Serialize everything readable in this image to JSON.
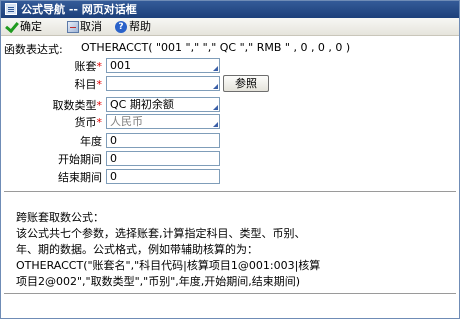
{
  "window": {
    "title": "公式导航 -- 网页对话框"
  },
  "toolbar": {
    "ok_label": "确定",
    "cancel_label": "取消",
    "help_label": "帮助",
    "help_glyph": "?"
  },
  "formula": {
    "label": "函数表达式:",
    "value": "OTHERACCT( \"001 \",\"  \",\" QC \",\" RMB \" , 0 , 0 , 0 )"
  },
  "form": {
    "required_mark": "*",
    "account_set": {
      "label": "账套",
      "value": "001"
    },
    "subject": {
      "label": "科目",
      "value": "",
      "ref_button": "参照"
    },
    "value_type": {
      "label": "取数类型",
      "value": "QC 期初余额"
    },
    "currency": {
      "label": "货币",
      "value": "人民币"
    },
    "year": {
      "label": "年度",
      "value": "0"
    },
    "start_period": {
      "label": "开始期间",
      "value": "0"
    },
    "end_period": {
      "label": "结束期间",
      "value": "0"
    }
  },
  "description": {
    "title": "跨账套取数公式：",
    "body": "该公式共七个参数，选择账套,计算指定科目、类型、币别、年、期的数据。公式格式，例如带辅助核算的为：  OTHERACCT(\"账套名\",\"科目代码|核算项目1@001:003|核算项目2@002\",\"取数类型\",\"币别\",年度,开始期间,结束期间)"
  },
  "colors": {
    "title_bar": "#1c3f7a",
    "required": "#e00000",
    "field_border": "#7f9db9"
  }
}
